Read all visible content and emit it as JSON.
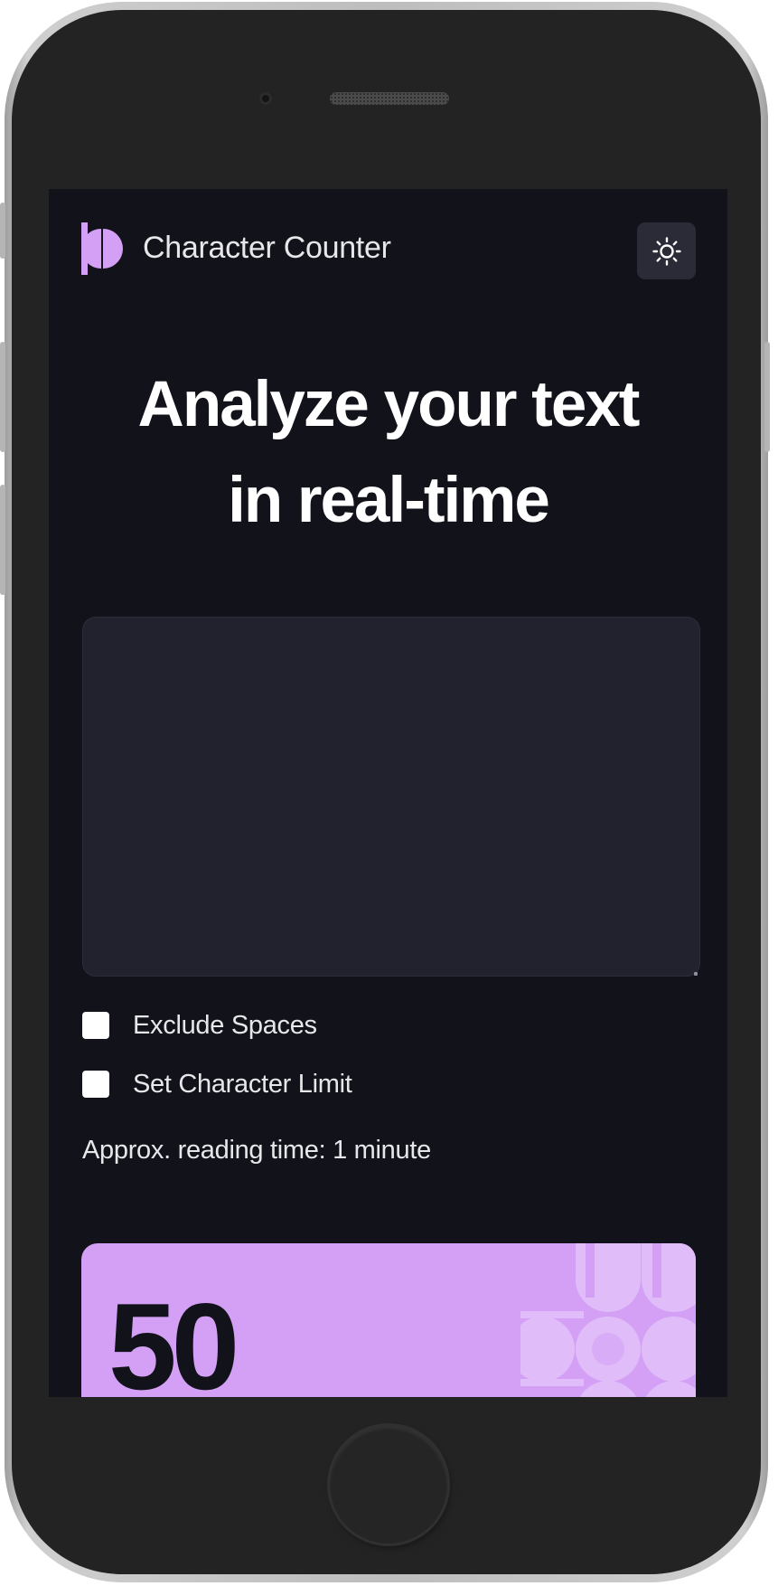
{
  "app": {
    "title": "Character Counter"
  },
  "hero": {
    "line1": "Analyze your text",
    "line2": "in real-time"
  },
  "textarea": {
    "value": "",
    "placeholder": ""
  },
  "options": {
    "exclude_spaces_label": "Exclude Spaces",
    "exclude_spaces_checked": false,
    "char_limit_label": "Set Character Limit",
    "char_limit_checked": false
  },
  "reading_time": "Approx. reading time: 1 minute",
  "stats": {
    "characters_value": "50"
  },
  "colors": {
    "background": "#12131a",
    "surface": "#21222e",
    "accent": "#d3a0f5",
    "text": "#e7e7ea"
  },
  "icons": {
    "logo": "character-counter-logo-icon",
    "theme_toggle": "sun-icon"
  }
}
